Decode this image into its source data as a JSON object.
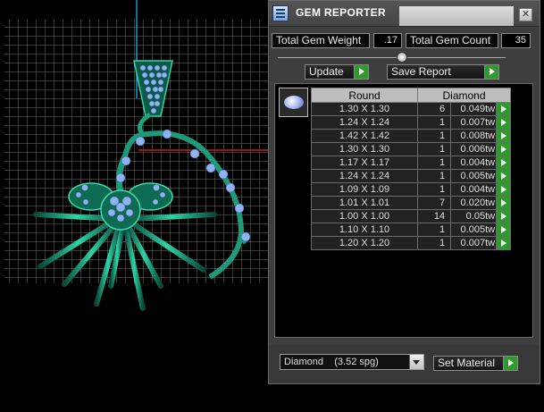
{
  "window": {
    "title": "GEM REPORTER",
    "close_glyph": "✕"
  },
  "totals": {
    "weight_label": "Total Gem Weight",
    "weight_value": ".17",
    "count_label": "Total Gem Count",
    "count_value": "35"
  },
  "actions": {
    "update_label": "Update",
    "save_label": "Save Report"
  },
  "table": {
    "headers": [
      "Round",
      "Diamond"
    ],
    "rows": [
      {
        "size": "1.30 X 1.30",
        "count": "6",
        "weight": "0.049tw"
      },
      {
        "size": "1.24 X 1.24",
        "count": "1",
        "weight": "0.007tw"
      },
      {
        "size": "1.42 X 1.42",
        "count": "1",
        "weight": "0.008tw"
      },
      {
        "size": "1.30 X 1.30",
        "count": "1",
        "weight": "0.006tw"
      },
      {
        "size": "1.17 X 1.17",
        "count": "1",
        "weight": "0.004tw"
      },
      {
        "size": "1.24 X 1.24",
        "count": "1",
        "weight": "0.005tw"
      },
      {
        "size": "1.09 X 1.09",
        "count": "1",
        "weight": "0.004tw"
      },
      {
        "size": "1.01 X 1.01",
        "count": "7",
        "weight": "0.020tw"
      },
      {
        "size": "1.00 X 1.00",
        "count": "14",
        "weight": "0.05tw"
      },
      {
        "size": "1.10 X 1.10",
        "count": "1",
        "weight": "0.005tw"
      },
      {
        "size": "1.20 X 1.20",
        "count": "1",
        "weight": "0.007tw"
      }
    ]
  },
  "material": {
    "selected": "Diamond    (3.52 spg)",
    "set_label": "Set Material"
  },
  "colors": {
    "accent_green": "#2e9a2e",
    "gem_blue": "#8fb3f0",
    "model_teal": "#0f7a60"
  },
  "icons": [
    "gem-reporter-app-icon",
    "close-icon",
    "slider-knob",
    "play-arrow-icon",
    "round-gem-icon",
    "dropdown-arrow-icon"
  ]
}
